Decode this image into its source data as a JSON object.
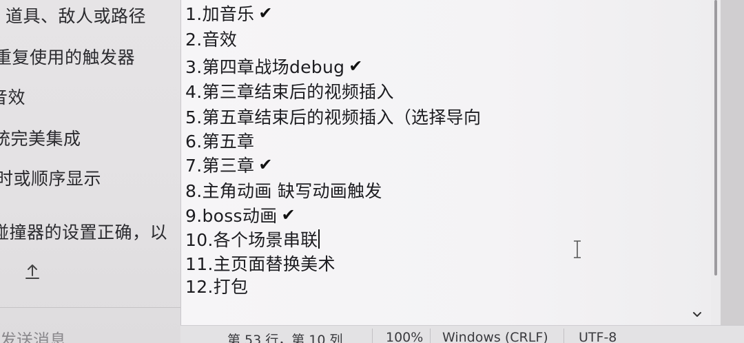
{
  "chat": {
    "lines": [
      "道具、敌人或路径",
      "重复使用的触发器",
      "音效",
      "统完美集成",
      "时或顺序显示",
      "碰撞器的设置正确，以"
    ],
    "input_placeholder": "发送消息",
    "upload_icon": "upload-icon"
  },
  "editor": {
    "lines": [
      {
        "text": "1.加音乐",
        "checked": true
      },
      {
        "text": "2.音效",
        "checked": false
      },
      {
        "text": "3.第四章战场debug",
        "checked": true
      },
      {
        "text": "4.第三章结束后的视频插入",
        "checked": false
      },
      {
        "text": "5.第五章结束后的视频插入（选择导向",
        "checked": false
      },
      {
        "text": "6.第五章",
        "checked": false
      },
      {
        "text": "7.第三章",
        "checked": true
      },
      {
        "text": "8.主角动画 缺写动画触发",
        "checked": false
      },
      {
        "text": "9.boss动画",
        "checked": true
      },
      {
        "text": "10.各个场景串联",
        "checked": false
      },
      {
        "text": "11.主页面替换美术",
        "checked": false
      },
      {
        "text": "12.打包",
        "checked": false
      }
    ],
    "check_glyph": "✔"
  },
  "statusbar": {
    "position": "第 53 行，第 10 列",
    "zoom": "100%",
    "line_ending": "Windows (CRLF)",
    "encoding": "UTF-8"
  }
}
